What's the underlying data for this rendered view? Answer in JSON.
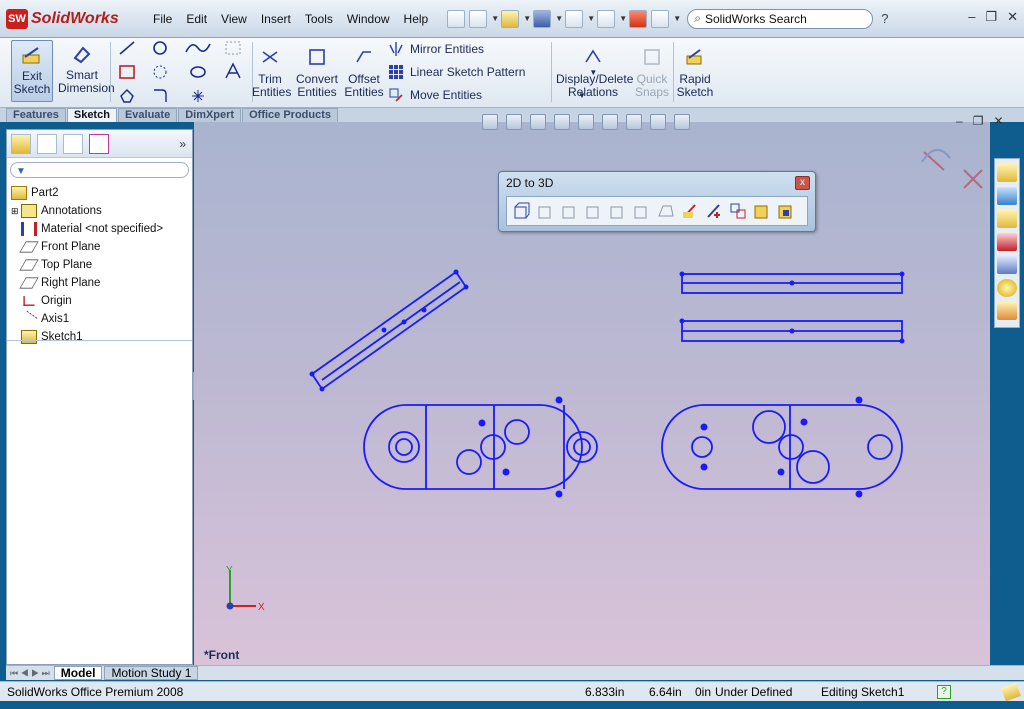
{
  "app": {
    "brand": "SolidWorks",
    "brand_badge": "SW",
    "search_placeholder": "SolidWorks Search",
    "help_icon": "help-icon",
    "window_controls": [
      "–",
      "❐",
      "✕"
    ]
  },
  "menu": [
    "File",
    "Edit",
    "View",
    "Insert",
    "Tools",
    "Window",
    "Help"
  ],
  "command_manager": {
    "exit_sketch": [
      "Exit",
      "Sketch"
    ],
    "smart_dimension": [
      "Smart",
      "Dimension"
    ],
    "trim": [
      "Trim",
      "Entities"
    ],
    "convert": [
      "Convert",
      "Entities"
    ],
    "offset": [
      "Offset",
      "Entities"
    ],
    "mirror": "Mirror Entities",
    "linear_pattern": "Linear Sketch Pattern",
    "move": "Move Entities",
    "display_delete": [
      "Display/Delete",
      "Relations"
    ],
    "quick_snaps": [
      "Quick",
      "Snaps"
    ],
    "rapid_sketch": [
      "Rapid",
      "Sketch"
    ]
  },
  "tabs": [
    "Features",
    "Sketch",
    "Evaluate",
    "DimXpert",
    "Office Products"
  ],
  "active_tab": "Sketch",
  "tree": {
    "root": "Part2",
    "items": [
      {
        "label": "Annotations",
        "icon": "annotations-icon"
      },
      {
        "label": "Material <not specified>",
        "icon": "material-icon"
      },
      {
        "label": "Front Plane",
        "icon": "plane-icon"
      },
      {
        "label": "Top Plane",
        "icon": "plane-icon"
      },
      {
        "label": "Right Plane",
        "icon": "plane-icon"
      },
      {
        "label": "Origin",
        "icon": "origin-icon"
      },
      {
        "label": "Axis1",
        "icon": "axis-icon"
      },
      {
        "label": "Sketch1",
        "icon": "sketch-icon"
      }
    ]
  },
  "bottom_tabs": [
    "Model",
    "Motion Study 1"
  ],
  "floating_toolbar": {
    "title": "2D to 3D",
    "close": "x"
  },
  "view": {
    "label": "*Front",
    "axis_x": "X",
    "axis_y": "Y"
  },
  "status": {
    "product": "SolidWorks Office Premium 2008",
    "x": "6.833in",
    "y": "6.64in",
    "z": "0in",
    "state": "Under Defined",
    "editing": "Editing Sketch1"
  },
  "colors": {
    "sketch": "#1a1aff",
    "accent": "#0f5d8e",
    "brand": "#c8201f"
  }
}
